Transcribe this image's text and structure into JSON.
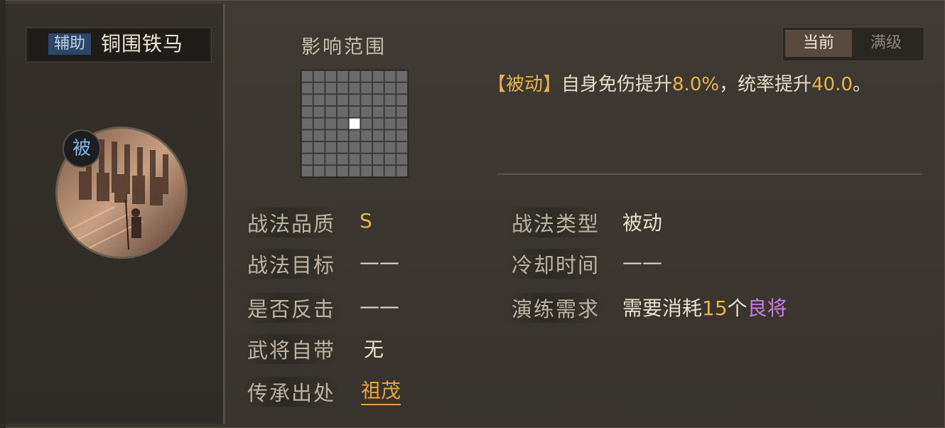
{
  "skill": {
    "type_tag": "辅助",
    "name": "铜围铁马",
    "passive_badge": "被"
  },
  "range": {
    "title": "影响范围",
    "grid_size": 9,
    "highlight_cell": [
      4,
      4
    ]
  },
  "tabs": {
    "current": "当前",
    "max": "满级",
    "selected": "当前"
  },
  "description": {
    "tag": "【被动】",
    "text1": "自身免伤提升",
    "value1": "8.0%",
    "text2": "，统率提升",
    "value2": "40.0",
    "text3": "。"
  },
  "info_left": [
    {
      "label": "战法品质",
      "value": "S"
    },
    {
      "label": "战法目标",
      "value": "——"
    },
    {
      "label": "是否反击",
      "value": "——"
    },
    {
      "label": "武将自带",
      "value": "无"
    },
    {
      "label": "传承出处",
      "value": "祖茂"
    }
  ],
  "info_right": [
    {
      "label": "战法类型",
      "value": "被动"
    },
    {
      "label": "冷却时间",
      "value": "——"
    },
    {
      "label": "演练需求",
      "value_prefix": "需要消耗",
      "value_count": "15",
      "value_mid": "个",
      "value_item": "良将"
    }
  ],
  "colors": {
    "accent_gold": "#e2b54a",
    "item_purple": "#c77be6",
    "link_orange": "#e8a436",
    "tag_blue": "#2f4766"
  }
}
